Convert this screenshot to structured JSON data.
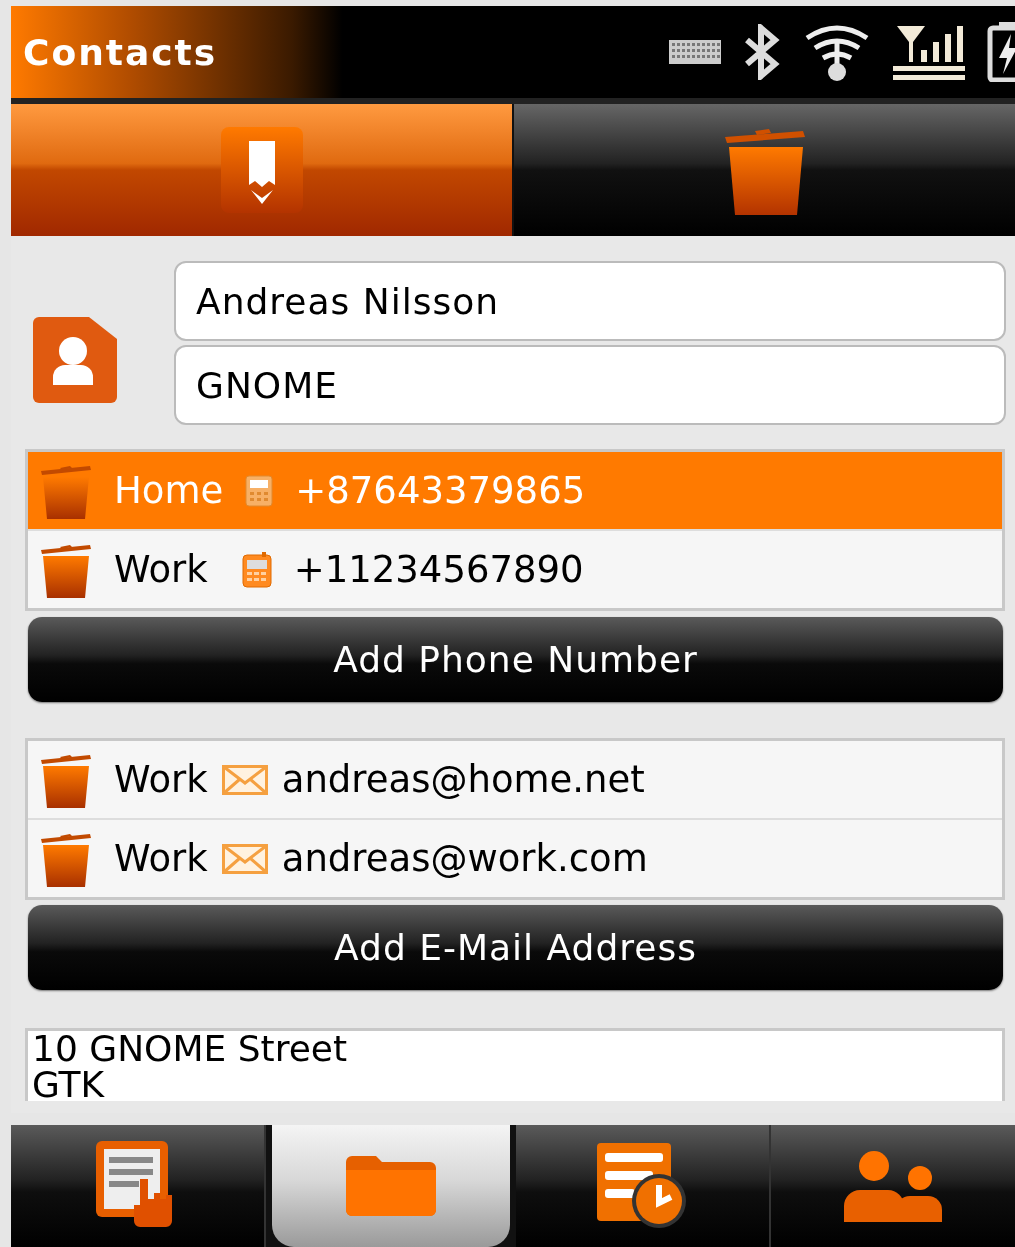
{
  "window": {
    "title": "Contacts"
  },
  "toolbar": [
    {
      "kind": "edit",
      "selected": true
    },
    {
      "kind": "delete",
      "selected": false
    }
  ],
  "name_fields": [
    {
      "value": "Andreas Nilsson"
    },
    {
      "value": "GNOME"
    }
  ],
  "phones": [
    {
      "label": "Home",
      "kind": "landline",
      "number": "+87643379865",
      "selected": true
    },
    {
      "label": "Work",
      "kind": "mobile",
      "number": "+11234567890",
      "selected": false
    }
  ],
  "add_phone_button": "Add Phone Number",
  "emails": [
    {
      "label": "Work",
      "address": "andreas@home.net",
      "selected": false
    },
    {
      "label": "Work",
      "address": "andreas@work.com",
      "selected": false
    }
  ],
  "add_email_button": "Add E-Mail Address",
  "address": {
    "lines": [
      "10 GNOME Street",
      "GTK"
    ]
  },
  "bottom_nav": [
    {
      "kind": "details",
      "selected": false
    },
    {
      "kind": "folder",
      "selected": true
    },
    {
      "kind": "history",
      "selected": false
    },
    {
      "kind": "contacts",
      "selected": false
    }
  ]
}
